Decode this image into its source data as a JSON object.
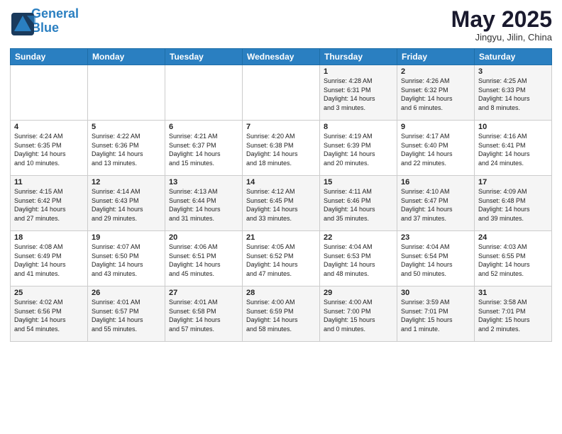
{
  "header": {
    "logo_line1": "General",
    "logo_line2": "Blue",
    "month": "May 2025",
    "location": "Jingyu, Jilin, China"
  },
  "days_of_week": [
    "Sunday",
    "Monday",
    "Tuesday",
    "Wednesday",
    "Thursday",
    "Friday",
    "Saturday"
  ],
  "weeks": [
    [
      {
        "num": "",
        "info": ""
      },
      {
        "num": "",
        "info": ""
      },
      {
        "num": "",
        "info": ""
      },
      {
        "num": "",
        "info": ""
      },
      {
        "num": "1",
        "info": "Sunrise: 4:28 AM\nSunset: 6:31 PM\nDaylight: 14 hours\nand 3 minutes."
      },
      {
        "num": "2",
        "info": "Sunrise: 4:26 AM\nSunset: 6:32 PM\nDaylight: 14 hours\nand 6 minutes."
      },
      {
        "num": "3",
        "info": "Sunrise: 4:25 AM\nSunset: 6:33 PM\nDaylight: 14 hours\nand 8 minutes."
      }
    ],
    [
      {
        "num": "4",
        "info": "Sunrise: 4:24 AM\nSunset: 6:35 PM\nDaylight: 14 hours\nand 10 minutes."
      },
      {
        "num": "5",
        "info": "Sunrise: 4:22 AM\nSunset: 6:36 PM\nDaylight: 14 hours\nand 13 minutes."
      },
      {
        "num": "6",
        "info": "Sunrise: 4:21 AM\nSunset: 6:37 PM\nDaylight: 14 hours\nand 15 minutes."
      },
      {
        "num": "7",
        "info": "Sunrise: 4:20 AM\nSunset: 6:38 PM\nDaylight: 14 hours\nand 18 minutes."
      },
      {
        "num": "8",
        "info": "Sunrise: 4:19 AM\nSunset: 6:39 PM\nDaylight: 14 hours\nand 20 minutes."
      },
      {
        "num": "9",
        "info": "Sunrise: 4:17 AM\nSunset: 6:40 PM\nDaylight: 14 hours\nand 22 minutes."
      },
      {
        "num": "10",
        "info": "Sunrise: 4:16 AM\nSunset: 6:41 PM\nDaylight: 14 hours\nand 24 minutes."
      }
    ],
    [
      {
        "num": "11",
        "info": "Sunrise: 4:15 AM\nSunset: 6:42 PM\nDaylight: 14 hours\nand 27 minutes."
      },
      {
        "num": "12",
        "info": "Sunrise: 4:14 AM\nSunset: 6:43 PM\nDaylight: 14 hours\nand 29 minutes."
      },
      {
        "num": "13",
        "info": "Sunrise: 4:13 AM\nSunset: 6:44 PM\nDaylight: 14 hours\nand 31 minutes."
      },
      {
        "num": "14",
        "info": "Sunrise: 4:12 AM\nSunset: 6:45 PM\nDaylight: 14 hours\nand 33 minutes."
      },
      {
        "num": "15",
        "info": "Sunrise: 4:11 AM\nSunset: 6:46 PM\nDaylight: 14 hours\nand 35 minutes."
      },
      {
        "num": "16",
        "info": "Sunrise: 4:10 AM\nSunset: 6:47 PM\nDaylight: 14 hours\nand 37 minutes."
      },
      {
        "num": "17",
        "info": "Sunrise: 4:09 AM\nSunset: 6:48 PM\nDaylight: 14 hours\nand 39 minutes."
      }
    ],
    [
      {
        "num": "18",
        "info": "Sunrise: 4:08 AM\nSunset: 6:49 PM\nDaylight: 14 hours\nand 41 minutes."
      },
      {
        "num": "19",
        "info": "Sunrise: 4:07 AM\nSunset: 6:50 PM\nDaylight: 14 hours\nand 43 minutes."
      },
      {
        "num": "20",
        "info": "Sunrise: 4:06 AM\nSunset: 6:51 PM\nDaylight: 14 hours\nand 45 minutes."
      },
      {
        "num": "21",
        "info": "Sunrise: 4:05 AM\nSunset: 6:52 PM\nDaylight: 14 hours\nand 47 minutes."
      },
      {
        "num": "22",
        "info": "Sunrise: 4:04 AM\nSunset: 6:53 PM\nDaylight: 14 hours\nand 48 minutes."
      },
      {
        "num": "23",
        "info": "Sunrise: 4:04 AM\nSunset: 6:54 PM\nDaylight: 14 hours\nand 50 minutes."
      },
      {
        "num": "24",
        "info": "Sunrise: 4:03 AM\nSunset: 6:55 PM\nDaylight: 14 hours\nand 52 minutes."
      }
    ],
    [
      {
        "num": "25",
        "info": "Sunrise: 4:02 AM\nSunset: 6:56 PM\nDaylight: 14 hours\nand 54 minutes."
      },
      {
        "num": "26",
        "info": "Sunrise: 4:01 AM\nSunset: 6:57 PM\nDaylight: 14 hours\nand 55 minutes."
      },
      {
        "num": "27",
        "info": "Sunrise: 4:01 AM\nSunset: 6:58 PM\nDaylight: 14 hours\nand 57 minutes."
      },
      {
        "num": "28",
        "info": "Sunrise: 4:00 AM\nSunset: 6:59 PM\nDaylight: 14 hours\nand 58 minutes."
      },
      {
        "num": "29",
        "info": "Sunrise: 4:00 AM\nSunset: 7:00 PM\nDaylight: 15 hours\nand 0 minutes."
      },
      {
        "num": "30",
        "info": "Sunrise: 3:59 AM\nSunset: 7:01 PM\nDaylight: 15 hours\nand 1 minute."
      },
      {
        "num": "31",
        "info": "Sunrise: 3:58 AM\nSunset: 7:01 PM\nDaylight: 15 hours\nand 2 minutes."
      }
    ]
  ]
}
